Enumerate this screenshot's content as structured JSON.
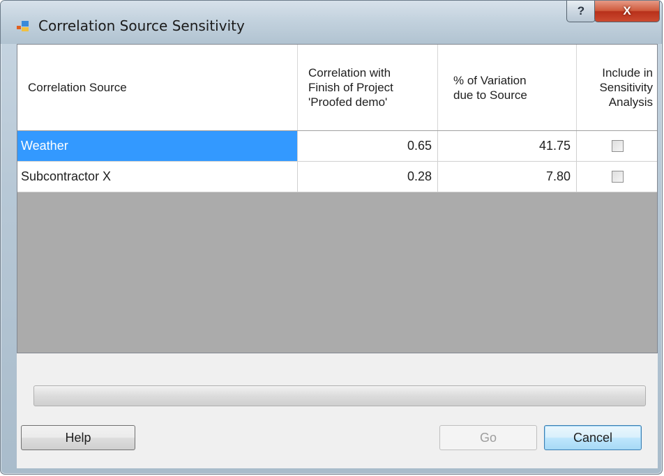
{
  "window": {
    "title": "Correlation Source Sensitivity",
    "help_glyph": "?",
    "close_glyph": "X"
  },
  "grid": {
    "columns": [
      {
        "label": "Correlation Source"
      },
      {
        "label": "Correlation with\nFinish of Project\n'Proofed demo'"
      },
      {
        "label": "% of Variation\ndue to Source"
      },
      {
        "label": "Include in\nSensitivity\nAnalysis"
      }
    ],
    "rows": [
      {
        "source": "Weather",
        "correlation": "0.65",
        "variation": "41.75",
        "include": false,
        "selected": true
      },
      {
        "source": "Subcontractor X",
        "correlation": "0.28",
        "variation": "7.80",
        "include": false,
        "selected": false
      }
    ]
  },
  "progress": {
    "value": 0
  },
  "buttons": {
    "help": "Help",
    "go": "Go",
    "cancel": "Cancel"
  },
  "colors": {
    "selection": "#3399ff",
    "grid_empty": "#ababab"
  }
}
